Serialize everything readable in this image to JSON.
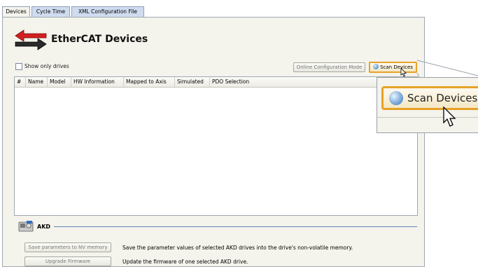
{
  "tabs": [
    {
      "label": "Devices",
      "active": true
    },
    {
      "label": "Cycle Time",
      "active": false
    },
    {
      "label": "XML Configuration File",
      "active": false
    }
  ],
  "header": {
    "title": "EtherCAT Devices",
    "icon": "ethercat-arrows-icon"
  },
  "toolbar": {
    "show_only_drives_label": "Show only drives",
    "show_only_drives_checked": false,
    "online_config_label": "Online Configuration Mode",
    "scan_devices_label": "Scan Devices"
  },
  "table": {
    "columns": [
      "#",
      "Name",
      "Model",
      "HW Information",
      "Mapped to Axis",
      "Simulated",
      "PDO Selection"
    ],
    "rows": []
  },
  "zoom": {
    "scan_devices_label": "Scan Devices"
  },
  "akd": {
    "label": "AKD",
    "save_label": "Save parameters to NV memory",
    "save_desc": "Save the parameter values of selected AKD drives into the drive's non-volatile memory.",
    "upgrade_label": "Upgrade Firmware",
    "upgrade_desc": "Update the firmware of one selected AKD drive."
  },
  "colors": {
    "accent": "#e7a227",
    "panel": "#f4f3ec",
    "tab_inactive": "#cfdcf0",
    "section_line": "#5f86b8"
  }
}
